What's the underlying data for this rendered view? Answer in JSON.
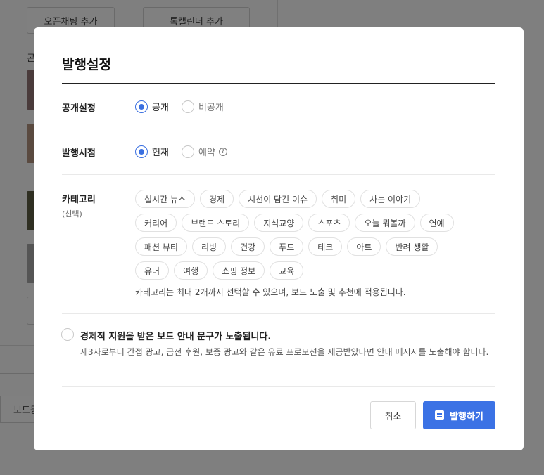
{
  "background": {
    "openchat_button": "오픈채팅 추가",
    "talkcal_button": "톡캘린더 추가",
    "section_label": "콘",
    "board_button": "보드등"
  },
  "modal": {
    "title": "발행설정",
    "visibility": {
      "label": "공개설정",
      "options": [
        "공개",
        "비공개"
      ],
      "selected": "공개"
    },
    "publish_time": {
      "label": "발행시점",
      "options": [
        "현재",
        "예약"
      ],
      "selected": "현재",
      "help_icon": "?"
    },
    "category": {
      "label": "카테고리",
      "sublabel": "(선택)",
      "chips": [
        "실시간 뉴스",
        "경제",
        "시선이 담긴 이슈",
        "취미",
        "사는 이야기",
        "커리어",
        "브랜드 스토리",
        "지식교양",
        "스포츠",
        "오늘 뭐볼까",
        "연예",
        "패션 뷰티",
        "리빙",
        "건강",
        "푸드",
        "테크",
        "아트",
        "반려 생활",
        "유머",
        "여행",
        "쇼핑 정보",
        "교육"
      ],
      "note": "카테고리는 최대 2개까지 선택할 수 있으며, 보드 노출 및 추천에 적용됩니다."
    },
    "sponsor": {
      "title": "경제적 지원을 받은 보드 안내 문구가 노출됩니다.",
      "description": "제3자로부터 간접 광고, 금전 후원, 보증 광고와 같은 유료 프로모션을 제공받았다면 안내 메시지를 노출해야 합니다."
    },
    "buttons": {
      "cancel": "취소",
      "publish": "발행하기"
    }
  },
  "colors": {
    "accent": "#3b72e5",
    "overlay": "#7f7f7f"
  }
}
